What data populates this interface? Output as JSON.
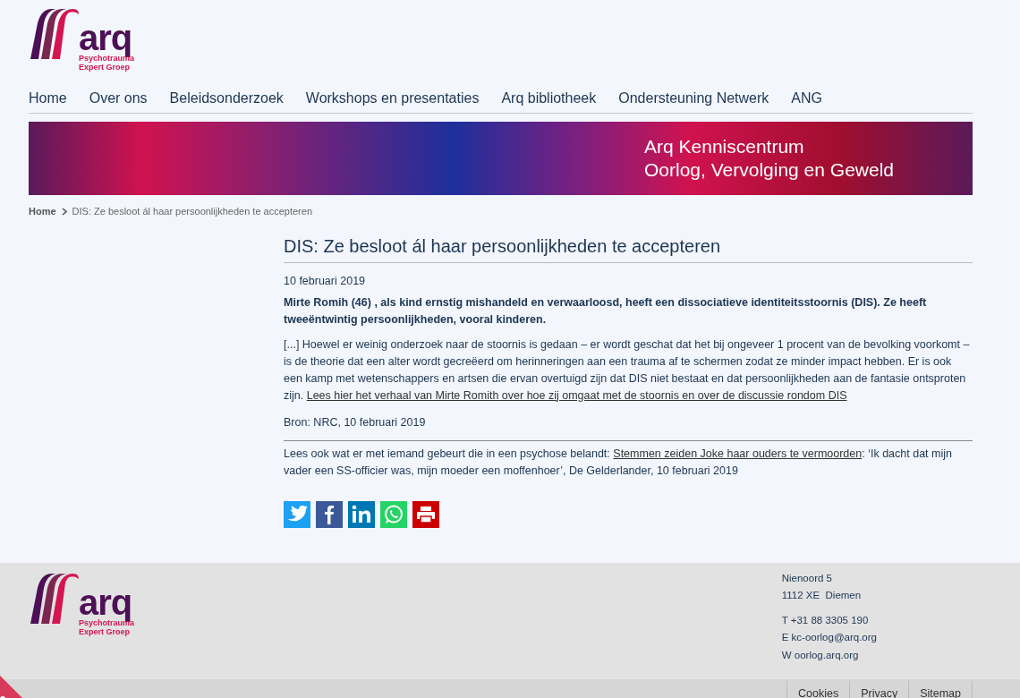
{
  "header": {
    "logo": {
      "wordmark": "arq",
      "tagline_1": "Psychotrauma",
      "tagline_2": "Expert Groep"
    }
  },
  "nav": [
    "Home",
    "Over ons",
    "Beleidsonderzoek",
    "Workshops en presentaties",
    "Arq bibliotheek",
    "Ondersteuning Netwerk",
    "ANG"
  ],
  "banner": {
    "line_1": "Arq Kenniscentrum",
    "line_2": "Oorlog, Vervolging en Geweld"
  },
  "breadcrumb": {
    "home": "Home",
    "current": "DIS: Ze besloot ál haar persoonlijkheden te accepteren"
  },
  "article": {
    "title": "DIS: Ze besloot ál haar persoonlijkheden te accepteren",
    "date": "10 februari 2019",
    "lead": "Mirte Romih (46) , als kind ernstig mishandeld en verwaarloosd, heeft een dissociatieve identiteitsstoornis (DIS). Ze heeft tweeëntwintig persoonlijkheden, vooral kinderen.",
    "body": "[...] Hoewel er weinig onderzoek naar de stoornis is gedaan – er wordt geschat dat het bij ongeveer 1 procent van de bevolking voorkomt – is de theorie dat een alter wordt gecreëerd om herinneringen aan een trauma af te schermen zodat ze minder impact hebben. Er is ook een kamp met wetenschappers en artsen die ervan overtuigd zijn dat DIS niet bestaat en dat persoonlijkheden aan de fantasie ontsproten zijn.",
    "body_link": "Lees hier het verhaal van Mirte Romith over hoe zij omgaat met de stoornis en over de discussie rondom DIS",
    "source": "Bron: NRC, 10 februari 2019",
    "related_intro": "Lees ook wat er met iemand gebeurt die in een psychose belandt:",
    "related_link": "Stemmen zeiden Joke haar ouders te vermoorden",
    "related_rest": ": ‘Ik dacht dat mijn vader een SS-officier was, mijn moeder een moffenhoer’, De Gelderlander, 10 februari 2019",
    "share": [
      {
        "kind": "twitter"
      },
      {
        "kind": "facebook"
      },
      {
        "kind": "linkedin"
      },
      {
        "kind": "whatsapp"
      },
      {
        "kind": "print"
      }
    ]
  },
  "footer": {
    "logo": {
      "wordmark": "arq",
      "tagline_1": "Psychotrauma",
      "tagline_2": "Expert Groep"
    },
    "address": [
      "Nienoord 5",
      "1112 XE  Diemen"
    ],
    "contact": [
      "T +31 88 3305 190",
      "E kc-oorlog@arq.org",
      "W oorlog.arq.org"
    ],
    "links": [
      "Cookies",
      "Privacy",
      "Sitemap"
    ]
  }
}
